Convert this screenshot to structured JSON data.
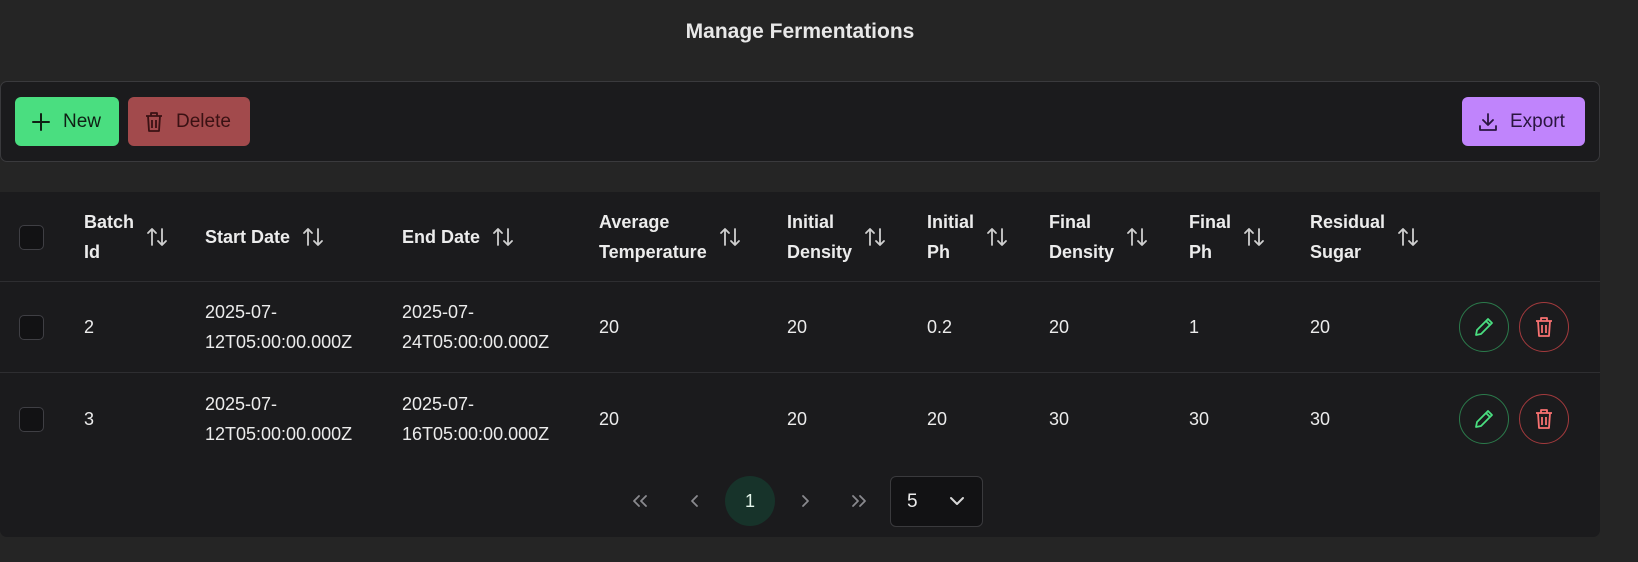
{
  "page": {
    "title": "Manage Fermentations"
  },
  "toolbar": {
    "new_label": "New",
    "delete_label": "Delete",
    "export_label": "Export"
  },
  "table": {
    "columns": [
      {
        "line1": "Batch",
        "line2": "Id"
      },
      {
        "line1": "Start Date",
        "line2": ""
      },
      {
        "line1": "End Date",
        "line2": ""
      },
      {
        "line1": "Average",
        "line2": "Temperature"
      },
      {
        "line1": "Initial",
        "line2": "Density"
      },
      {
        "line1": "Initial",
        "line2": "Ph"
      },
      {
        "line1": "Final",
        "line2": "Density"
      },
      {
        "line1": "Final",
        "line2": "Ph"
      },
      {
        "line1": "Residual",
        "line2": "Sugar"
      }
    ],
    "rows": [
      {
        "batch_id": "2",
        "start_line1": "2025-07-",
        "start_line2": "12T05:00:00.000Z",
        "end_line1": "2025-07-",
        "end_line2": "24T05:00:00.000Z",
        "avg_temp": "20",
        "initial_density": "20",
        "initial_ph": "0.2",
        "final_density": "20",
        "final_ph": "1",
        "residual_sugar": "20"
      },
      {
        "batch_id": "3",
        "start_line1": "2025-07-",
        "start_line2": "12T05:00:00.000Z",
        "end_line1": "2025-07-",
        "end_line2": "16T05:00:00.000Z",
        "avg_temp": "20",
        "initial_density": "20",
        "initial_ph": "20",
        "final_density": "30",
        "final_ph": "30",
        "residual_sugar": "30"
      }
    ]
  },
  "pagination": {
    "current_page": "1",
    "rows_per_page": "5"
  },
  "colors": {
    "background": "#252525",
    "panel": "#1b1b1d",
    "new": "#4ade80",
    "delete": "#a24a4c",
    "export": "#c084fc",
    "edit": "#4ade80",
    "remove": "#f87171"
  },
  "icons": {
    "new": "plus-icon",
    "delete": "trash-icon",
    "export": "download-icon",
    "sort": "sort-icon",
    "edit": "pencil-icon",
    "remove": "trash-icon"
  }
}
